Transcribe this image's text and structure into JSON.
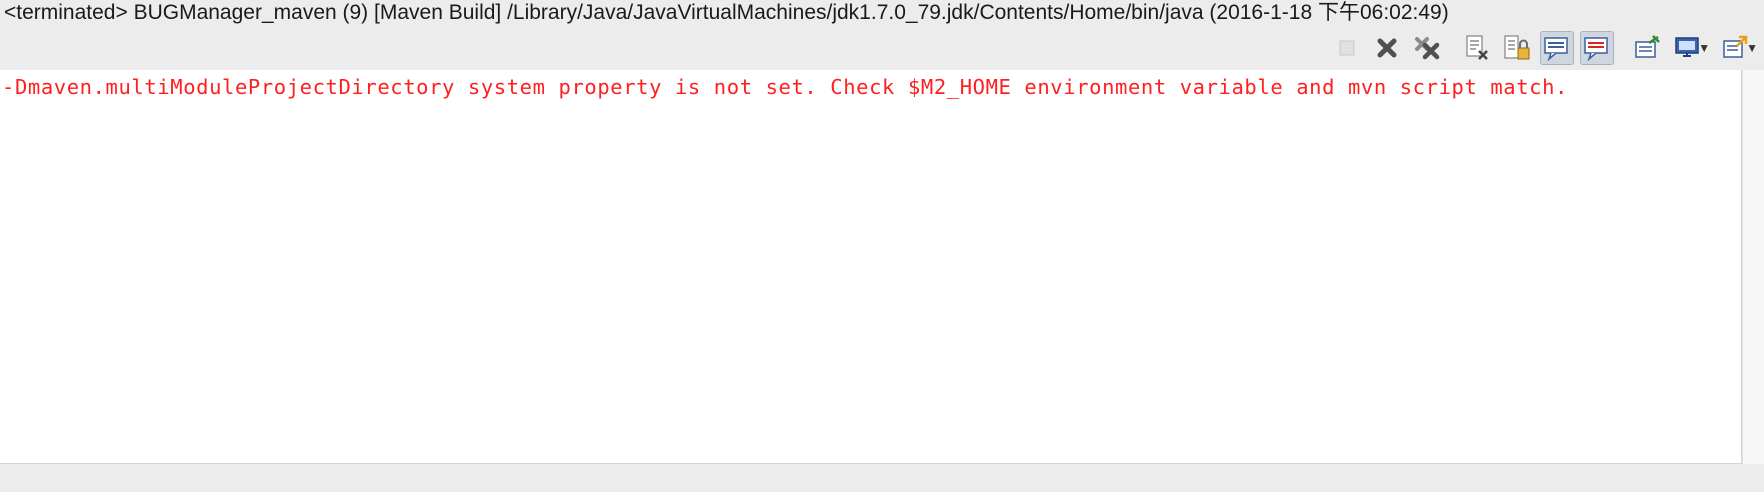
{
  "title_bar": {
    "text": "<terminated> BUGManager_maven (9) [Maven Build] /Library/Java/JavaVirtualMachines/jdk1.7.0_79.jdk/Contents/Home/bin/java (2016-1-18 下午06:02:49)"
  },
  "toolbar": {
    "buttons": [
      {
        "icon": "terminate-icon",
        "enabled": false
      },
      {
        "icon": "remove-launch-icon"
      },
      {
        "icon": "remove-all-terminated-icon"
      },
      {
        "icon": "clear-console-icon"
      },
      {
        "icon": "scroll-lock-icon"
      },
      {
        "icon": "show-console-stdout-icon",
        "pressed": true
      },
      {
        "icon": "show-console-stderr-icon",
        "pressed": true
      },
      {
        "icon": "pin-console-icon"
      },
      {
        "icon": "display-selected-console-icon",
        "has_dropdown": true
      },
      {
        "icon": "open-console-icon",
        "has_dropdown": true
      }
    ]
  },
  "console": {
    "lines": [
      "-Dmaven.multiModuleProjectDirectory system property is not set. Check $M2_HOME environment variable and mvn script match."
    ],
    "error_color": "#ff1f1f"
  }
}
